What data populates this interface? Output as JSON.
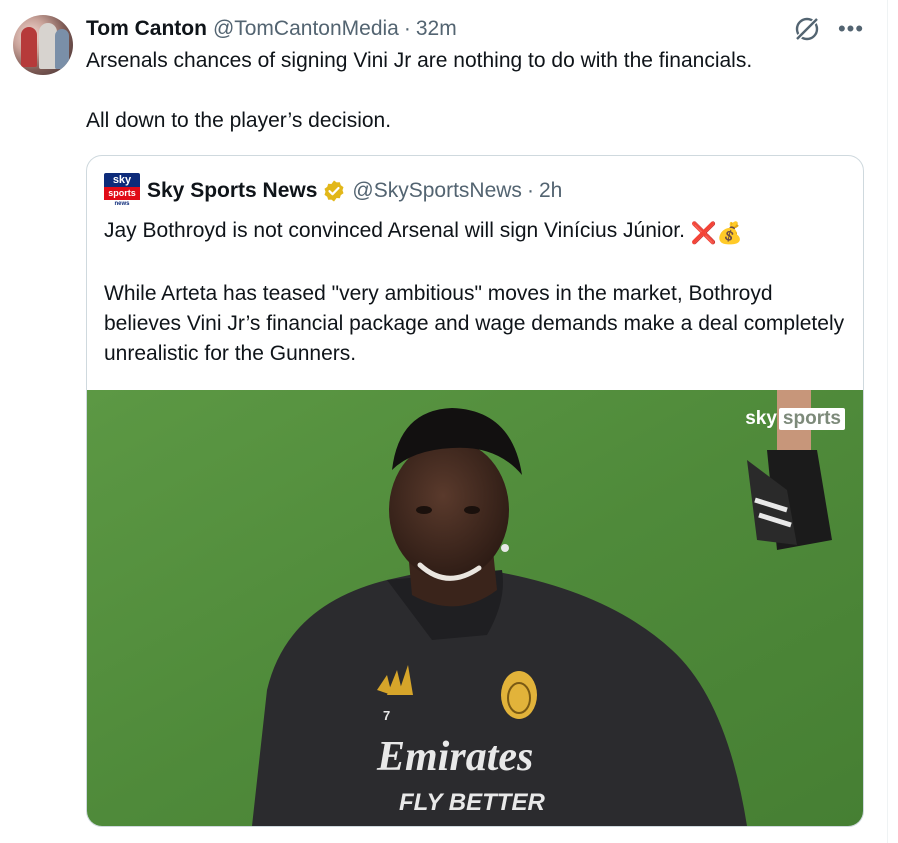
{
  "tweet": {
    "author_name": "Tom Canton",
    "handle": "@TomCantonMedia",
    "separator": "·",
    "time": "32m",
    "text_line1": "Arsenals chances of signing Vini Jr are nothing to do with the financials.",
    "text_line2": "All down to the player’s decision.",
    "icons": [
      "grok-icon",
      "more-icon"
    ],
    "more_glyph": "•••"
  },
  "quote": {
    "logo_top": "sky",
    "logo_mid": "sports",
    "logo_bot": "news",
    "author_name": "Sky Sports News",
    "handle": "@SkySportsNews",
    "separator": "·",
    "time": "2h",
    "text_para1": "Jay Bothroyd is not convinced Arsenal will sign Vinícius Júnior.",
    "emoji_cross": "❌",
    "emoji_money": "💰",
    "text_para2": "While Arteta has teased \"very ambitious\" moves in the market, Bothroyd believes Vini Jr’s financial package and wage demands make a deal completely unrealistic for the Gunners.",
    "image": {
      "watermark_sky": "sky",
      "watermark_sports": "sports",
      "shirt_sponsor": "Emirates",
      "shirt_tagline": "FLY BETTER",
      "shirt_number": "7"
    }
  },
  "colors": {
    "text": "#0f1419",
    "muted": "#536471",
    "border": "#cfd9de",
    "verified_gold": "#e2b719",
    "pitch_green": "#4f8a3a"
  }
}
